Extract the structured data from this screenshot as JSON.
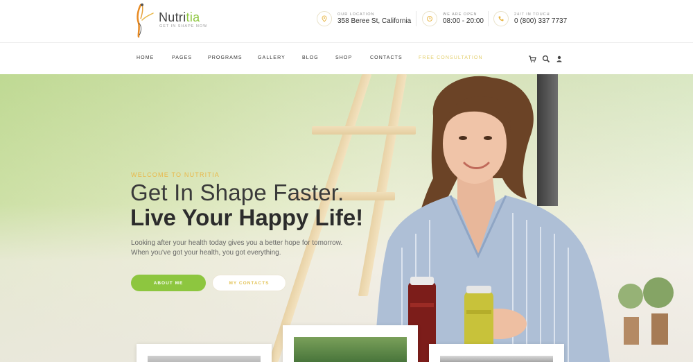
{
  "brand": {
    "name_prefix": "Nutri",
    "name_accent": "tia",
    "tagline": "GET IN SHAPE NOW",
    "accent_color": "#8dc63f",
    "highlight_color": "#e9b84a"
  },
  "header_info": [
    {
      "icon": "location-pin-icon",
      "label": "OUR LOCATION",
      "value": "358 Beree St, California"
    },
    {
      "icon": "clock-icon",
      "label": "WE ARE OPEN",
      "value": "08:00 - 20:00"
    },
    {
      "icon": "phone-icon",
      "label": "24/7 IN TOUCH",
      "value": "0 (800) 337 7737"
    }
  ],
  "nav": {
    "items": [
      "HOME",
      "PAGES",
      "PROGRAMS",
      "GALLERY",
      "BLOG",
      "SHOP",
      "CONTACTS",
      "FREE CONSULTATION"
    ],
    "icons": [
      "cart-icon",
      "search-icon",
      "user-icon"
    ]
  },
  "hero": {
    "eyebrow": "WELCOME TO NUTRITIA",
    "headline_line1": "Get In Shape Faster.",
    "headline_line2": "Live Your Happy Life!",
    "lead_line1": "Looking after your health today gives you a better hope for tomorrow.",
    "lead_line2": "When you've got your health, you got everything.",
    "primary_button": "ABOUT ME",
    "secondary_button": "MY CONTACTS"
  }
}
